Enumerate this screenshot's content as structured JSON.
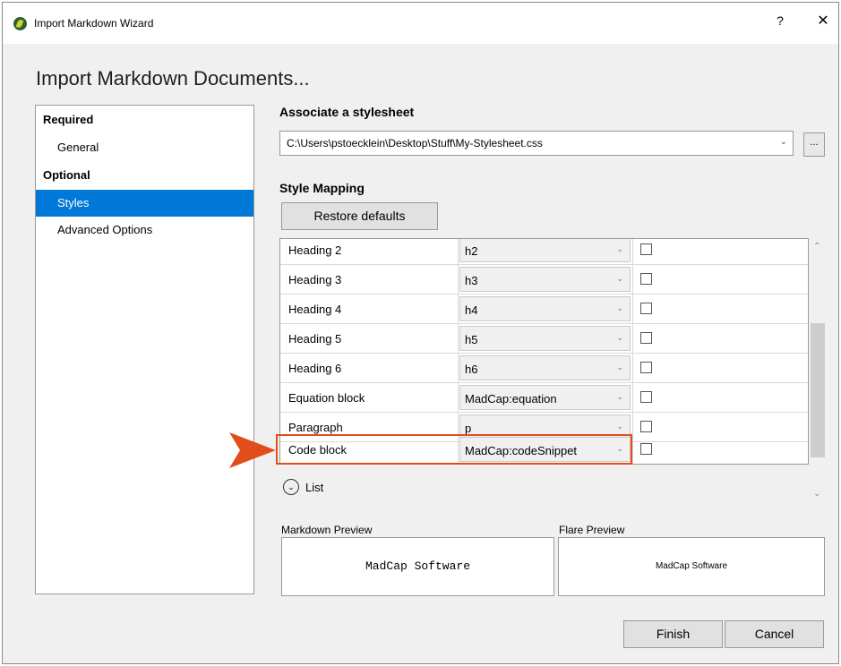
{
  "window": {
    "title": "Import Markdown Wizard",
    "help_label": "?",
    "close_label": "✕"
  },
  "heading": "Import Markdown Documents...",
  "nav": {
    "groups": [
      {
        "label": "Required",
        "items": [
          {
            "label": "General",
            "selected": false
          }
        ]
      },
      {
        "label": "Optional",
        "items": [
          {
            "label": "Styles",
            "selected": true
          },
          {
            "label": "Advanced Options",
            "selected": false
          }
        ]
      }
    ]
  },
  "stylesheet": {
    "title": "Associate a stylesheet",
    "path": "C:\\Users\\pstoecklein\\Desktop\\Stuff\\My-Stylesheet.css",
    "browse_label": "...",
    "arrow_icon": "chevron-down-icon"
  },
  "style_mapping": {
    "title": "Style Mapping",
    "restore_label": "Restore defaults",
    "rows": [
      {
        "name": "Heading 2",
        "style": "h2",
        "checked": false
      },
      {
        "name": "Heading 3",
        "style": "h3",
        "checked": false
      },
      {
        "name": "Heading 4",
        "style": "h4",
        "checked": false
      },
      {
        "name": "Heading 5",
        "style": "h5",
        "checked": false
      },
      {
        "name": "Heading 6",
        "style": "h6",
        "checked": false
      },
      {
        "name": "Equation block",
        "style": "MadCap:equation",
        "checked": false
      },
      {
        "name": "Paragraph",
        "style": "p",
        "checked": false
      },
      {
        "name": "Code block",
        "style": "MadCap:codeSnippet",
        "checked": false,
        "highlighted": true
      }
    ],
    "list_label": "List"
  },
  "preview": {
    "markdown_label": "Markdown Preview",
    "markdown_text": "MadCap Software",
    "flare_label": "Flare Preview",
    "flare_text": "MadCap Software"
  },
  "footer": {
    "finish_label": "Finish",
    "cancel_label": "Cancel"
  },
  "colors": {
    "accent": "#0078d7",
    "highlight": "#e14e1c",
    "background": "#f0f0f0"
  }
}
